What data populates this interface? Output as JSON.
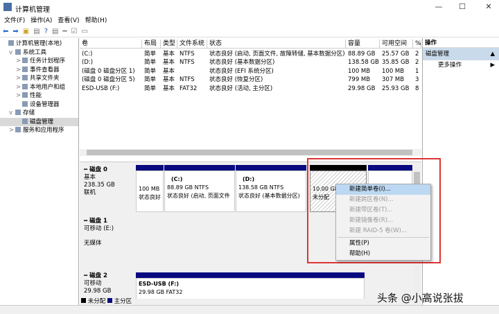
{
  "window": {
    "title": "计算机管理",
    "minimize": "—",
    "maximize": "☐",
    "close": "✕"
  },
  "menu": [
    "文件(F)",
    "操作(A)",
    "查看(V)",
    "帮助(H)"
  ],
  "tree": [
    {
      "label": "计算机管理(本地)",
      "indent": 0
    },
    {
      "label": "系统工具",
      "indent": 1,
      "toggle": "v"
    },
    {
      "label": "任务计划程序",
      "indent": 2,
      "toggle": ">"
    },
    {
      "label": "事件查看器",
      "indent": 2,
      "toggle": ">"
    },
    {
      "label": "共享文件夹",
      "indent": 2,
      "toggle": ">"
    },
    {
      "label": "本地用户和组",
      "indent": 2,
      "toggle": ">"
    },
    {
      "label": "性能",
      "indent": 2,
      "toggle": ">"
    },
    {
      "label": "设备管理器",
      "indent": 2
    },
    {
      "label": "存储",
      "indent": 1,
      "toggle": "v"
    },
    {
      "label": "磁盘管理",
      "indent": 2,
      "selected": true
    },
    {
      "label": "服务和应用程序",
      "indent": 1,
      "toggle": ">"
    }
  ],
  "table": {
    "headers": [
      "卷",
      "布局",
      "类型",
      "文件系统",
      "状态",
      "容量",
      "可用空间",
      "%"
    ],
    "rows": [
      [
        "(C:)",
        "简单",
        "基本",
        "NTFS",
        "状态良好 (启动, 页面文件, 故障转储, 基本数据分区)",
        "88.89 GB",
        "25.57 GB",
        "2"
      ],
      [
        "(D:)",
        "简单",
        "基本",
        "NTFS",
        "状态良好 (基本数据分区)",
        "138.58 GB",
        "35.85 GB",
        "2"
      ],
      [
        "(磁盘 0 磁盘分区 1)",
        "简单",
        "基本",
        "",
        "状态良好 (EFI 系统分区)",
        "100 MB",
        "100 MB",
        "1"
      ],
      [
        "(磁盘 0 磁盘分区 5)",
        "简单",
        "基本",
        "NTFS",
        "状态良好 (恢复分区)",
        "799 MB",
        "307 MB",
        "3"
      ],
      [
        "ESD-USB (F:)",
        "简单",
        "基本",
        "FAT32",
        "状态良好 (活动, 主分区)",
        "29.98 GB",
        "25.93 GB",
        "8"
      ]
    ]
  },
  "disks": {
    "d0": {
      "name": "磁盘 0",
      "type": "基本",
      "size": "238.35 GB",
      "state": "联机",
      "parts": [
        {
          "title": "",
          "size": "100 MB",
          "status": "状态良好"
        },
        {
          "title": "(C:)",
          "size": "88.89 GB NTFS",
          "status": "状态良好 (启动, 页面文件"
        },
        {
          "title": "(D:)",
          "size": "138.58 GB NTFS",
          "status": "状态良好 (基本数据分区)"
        },
        {
          "title": "",
          "size": "10.00 GB",
          "status": "未分配"
        }
      ]
    },
    "d1": {
      "name": "磁盘 1",
      "type": "可移动 (E:)",
      "state": "无媒体"
    },
    "d2": {
      "name": "磁盘 2",
      "type": "可移动",
      "size": "29.98 GB",
      "part_title": "ESD-USB  (F:)",
      "part_size": "29.98 GB FAT32"
    }
  },
  "legend": {
    "unallocated": "未分配",
    "primary": "主分区"
  },
  "actions": {
    "header": "操作",
    "section": "磁盘管理",
    "more": "更多操作"
  },
  "context_menu": [
    {
      "label": "新建简单卷(I)...",
      "enabled": true
    },
    {
      "label": "新建跨区卷(N)...",
      "enabled": false
    },
    {
      "label": "新建带区卷(T)...",
      "enabled": false
    },
    {
      "label": "新建镜像卷(R)...",
      "enabled": false
    },
    {
      "label": "新建 RAID-5 卷(W)...",
      "enabled": false
    },
    {
      "label": "属性(P)",
      "enabled": true
    },
    {
      "label": "帮助(H)",
      "enabled": true
    }
  ],
  "watermark": "头条 @小高说张拔"
}
